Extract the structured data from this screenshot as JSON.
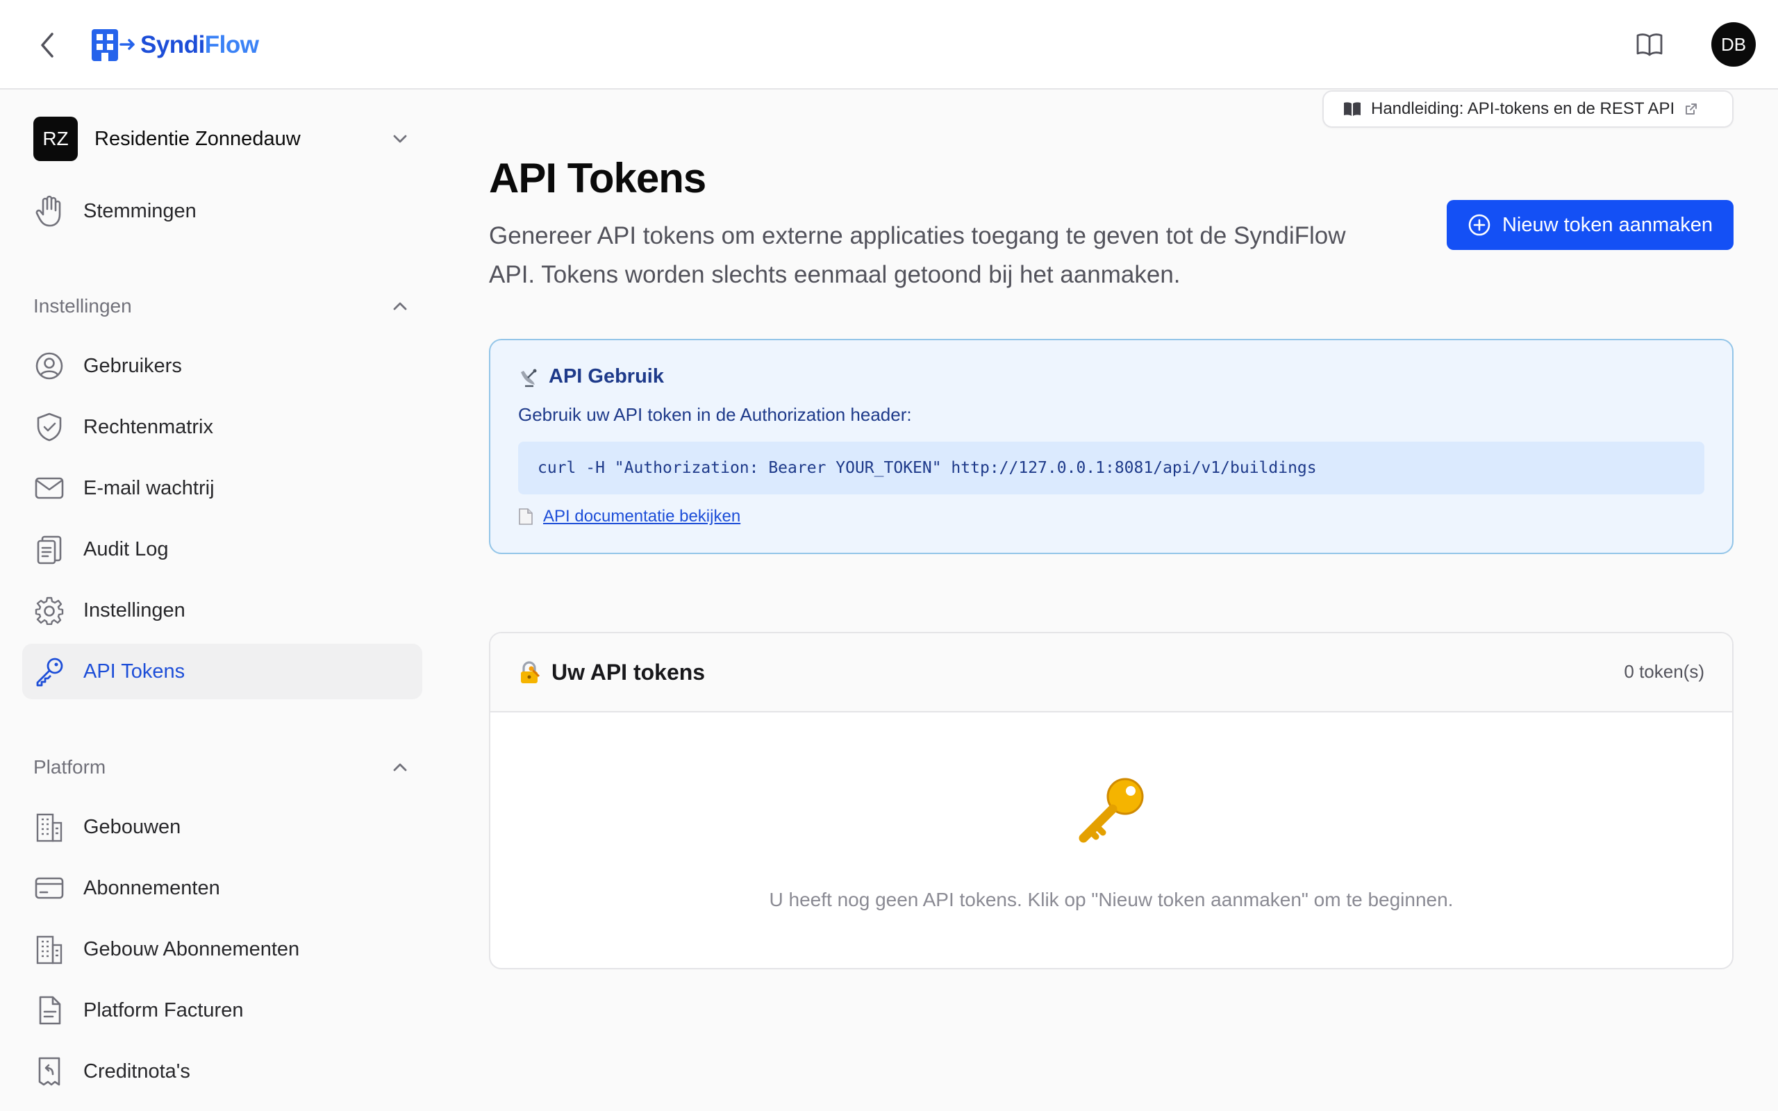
{
  "app": {
    "name_prefix": "Syndi",
    "name_suffix": "Flow",
    "user_initials": "DB",
    "accent": "#1450f5"
  },
  "sidebar": {
    "org": {
      "initials": "RZ",
      "name": "Residentie Zonnedauw"
    },
    "top_items": [
      {
        "label": "Stemmingen",
        "icon": "hand-icon"
      }
    ],
    "sections": [
      {
        "title": "Instellingen",
        "items": [
          {
            "label": "Gebruikers",
            "icon": "user-circle-icon"
          },
          {
            "label": "Rechtenmatrix",
            "icon": "shield-check-icon"
          },
          {
            "label": "E-mail wachtrij",
            "icon": "mail-icon"
          },
          {
            "label": "Audit Log",
            "icon": "clipboard-icon"
          },
          {
            "label": "Instellingen",
            "icon": "gear-icon"
          },
          {
            "label": "API Tokens",
            "icon": "key-icon",
            "active": true
          }
        ]
      },
      {
        "title": "Platform",
        "items": [
          {
            "label": "Gebouwen",
            "icon": "building-icon"
          },
          {
            "label": "Abonnementen",
            "icon": "credit-card-icon"
          },
          {
            "label": "Gebouw Abonnementen",
            "icon": "building-icon"
          },
          {
            "label": "Platform Facturen",
            "icon": "document-icon"
          },
          {
            "label": "Creditnota's",
            "icon": "receipt-refund-icon"
          }
        ]
      }
    ]
  },
  "main": {
    "manual_link": "Handleiding: API-tokens en de REST API",
    "title": "API Tokens",
    "description": "Genereer API tokens om externe applicaties toegang te geven tot de SyndiFlow API. Tokens worden slechts eenmaal getoond bij het aanmaken.",
    "new_token_button": "Nieuw token aanmaken",
    "info": {
      "title": "API Gebruik",
      "text": "Gebruik uw API token in de Authorization header:",
      "code": "curl -H \"Authorization: Bearer YOUR_TOKEN\" http://127.0.0.1:8081/api/v1/buildings",
      "doc_link": "API documentatie bekijken"
    },
    "tokens": {
      "title": "Uw API tokens",
      "count": "0 token(s)",
      "empty_text": "U heeft nog geen API tokens. Klik op \"Nieuw token aanmaken\" om te beginnen."
    }
  }
}
